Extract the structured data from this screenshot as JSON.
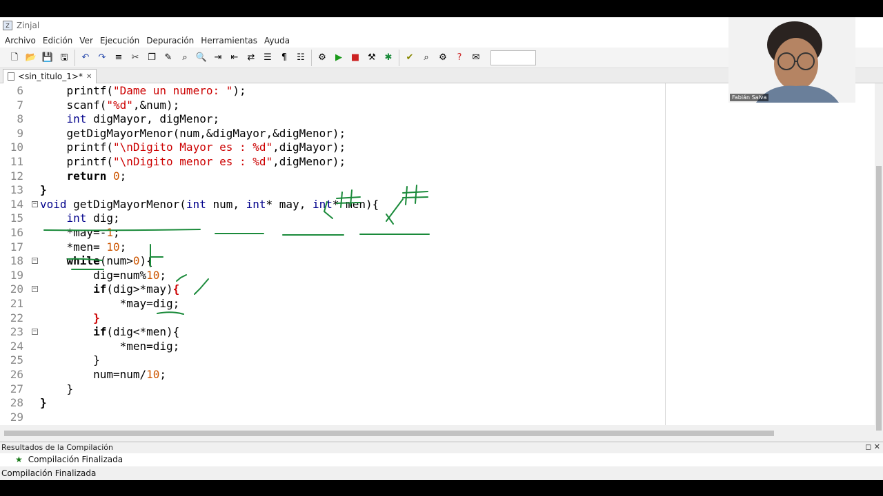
{
  "window": {
    "title": "Zinjal"
  },
  "menu": [
    "Archivo",
    "Edición",
    "Ver",
    "Ejecución",
    "Depuración",
    "Herramientas",
    "Ayuda"
  ],
  "toolbar": {
    "groups": [
      [
        "new-file-icon",
        "open-folder-icon",
        "save-icon",
        "save-as-icon"
      ],
      [
        "undo-icon",
        "redo-icon",
        "indent-icon",
        "cut-icon",
        "copy-icon",
        "comment-icon",
        "find-icon",
        "search-icon",
        "find-next-icon",
        "find-prev-icon",
        "replace-icon",
        "align-icon",
        "format-icon",
        "list-icon"
      ],
      [
        "compile-icon",
        "run-icon",
        "stop-icon",
        "build-icon",
        "debug-icon"
      ],
      [
        "check-icon",
        "inspect-icon",
        "tools-icon",
        "help-icon",
        "notes-icon"
      ]
    ]
  },
  "tabs": [
    {
      "label": "<sin_titulo_1>*"
    }
  ],
  "code_lines": [
    {
      "num": "6",
      "fold": "",
      "segments": [
        [
          "    ",
          "op"
        ],
        [
          "printf",
          "op"
        ],
        [
          "(",
          "op"
        ],
        [
          "\"Dame un numero: \"",
          "str"
        ],
        [
          ");",
          "op"
        ]
      ]
    },
    {
      "num": "7",
      "fold": "",
      "segments": [
        [
          "    ",
          "op"
        ],
        [
          "scanf",
          "op"
        ],
        [
          "(",
          "op"
        ],
        [
          "\"%d\"",
          "str"
        ],
        [
          ",&num);",
          "op"
        ]
      ]
    },
    {
      "num": "8",
      "fold": "",
      "segments": [
        [
          "    ",
          "op"
        ],
        [
          "int",
          "ty"
        ],
        [
          " digMayor, digMenor;",
          "op"
        ]
      ]
    },
    {
      "num": "9",
      "fold": "",
      "segments": [
        [
          "    ",
          "op"
        ],
        [
          "getDigMayorMenor(num,&digMayor,&digMenor);",
          "op"
        ]
      ]
    },
    {
      "num": "10",
      "fold": "",
      "segments": [
        [
          "    ",
          "op"
        ],
        [
          "printf(",
          "op"
        ],
        [
          "\"\\nDigito Mayor es : %d\"",
          "str"
        ],
        [
          ",digMayor);",
          "op"
        ]
      ]
    },
    {
      "num": "11",
      "fold": "",
      "segments": [
        [
          "    ",
          "op"
        ],
        [
          "printf(",
          "op"
        ],
        [
          "\"\\nDigito menor es : %d\"",
          "str"
        ],
        [
          ",digMenor);",
          "op"
        ]
      ]
    },
    {
      "num": "12",
      "fold": "",
      "segments": [
        [
          "    ",
          "op"
        ],
        [
          "return",
          "kw"
        ],
        [
          " ",
          "op"
        ],
        [
          "0",
          "num"
        ],
        [
          ";",
          "op"
        ]
      ]
    },
    {
      "num": "13",
      "fold": "",
      "segments": [
        [
          "}",
          "kw"
        ]
      ]
    },
    {
      "num": "14",
      "fold": "⊟",
      "segments": [
        [
          "void",
          "ty"
        ],
        [
          " getDigMayorMenor(",
          "op"
        ],
        [
          "int",
          "ty"
        ],
        [
          " num, ",
          "op"
        ],
        [
          "int",
          "ty"
        ],
        [
          "* may, ",
          "op"
        ],
        [
          "int",
          "ty"
        ],
        [
          "* men){",
          "op"
        ]
      ]
    },
    {
      "num": "15",
      "fold": "",
      "segments": [
        [
          "    ",
          "op"
        ],
        [
          "int",
          "ty"
        ],
        [
          " dig;",
          "op"
        ]
      ]
    },
    {
      "num": "16",
      "fold": "",
      "segments": [
        [
          "    ",
          "op"
        ],
        [
          "*may=-",
          "op"
        ],
        [
          "1",
          "num"
        ],
        [
          ";",
          "op"
        ]
      ]
    },
    {
      "num": "17",
      "fold": "",
      "segments": [
        [
          "    ",
          "op"
        ],
        [
          "*men= ",
          "op"
        ],
        [
          "10",
          "num"
        ],
        [
          ";",
          "op"
        ]
      ]
    },
    {
      "num": "18",
      "fold": "⊖",
      "segments": [
        [
          "    ",
          "op"
        ],
        [
          "while",
          "kw"
        ],
        [
          "(num>",
          "op"
        ],
        [
          "0",
          "num"
        ],
        [
          "){",
          "op"
        ]
      ]
    },
    {
      "num": "19",
      "fold": "",
      "segments": [
        [
          "        ",
          "op"
        ],
        [
          "dig=num%",
          "op"
        ],
        [
          "10",
          "num"
        ],
        [
          ";",
          "op"
        ]
      ]
    },
    {
      "num": "20",
      "fold": "⊖",
      "segments": [
        [
          "        ",
          "op"
        ],
        [
          "if",
          "kw"
        ],
        [
          "(dig>*may)",
          "op"
        ],
        [
          "{",
          "brace-red"
        ]
      ]
    },
    {
      "num": "21",
      "fold": "",
      "segments": [
        [
          "            ",
          "op"
        ],
        [
          "*may=dig;",
          "op"
        ]
      ]
    },
    {
      "num": "22",
      "fold": "",
      "segments": [
        [
          "        ",
          "op"
        ],
        [
          "}",
          "brace-red"
        ]
      ]
    },
    {
      "num": "23",
      "fold": "⊖",
      "segments": [
        [
          "        ",
          "op"
        ],
        [
          "if",
          "kw"
        ],
        [
          "(dig<*men){",
          "op"
        ]
      ]
    },
    {
      "num": "24",
      "fold": "",
      "segments": [
        [
          "            ",
          "op"
        ],
        [
          "*men=dig;",
          "op"
        ]
      ]
    },
    {
      "num": "25",
      "fold": "",
      "segments": [
        [
          "        ",
          "op"
        ],
        [
          "}",
          "op"
        ]
      ]
    },
    {
      "num": "26",
      "fold": "",
      "segments": [
        [
          "        ",
          "op"
        ],
        [
          "num=num/",
          "op"
        ],
        [
          "10",
          "num"
        ],
        [
          ";",
          "op"
        ]
      ]
    },
    {
      "num": "27",
      "fold": "",
      "segments": [
        [
          "    ",
          "op"
        ],
        [
          "}",
          "op"
        ]
      ]
    },
    {
      "num": "28",
      "fold": "",
      "segments": [
        [
          "}",
          "kw"
        ]
      ]
    },
    {
      "num": "29",
      "fold": "",
      "segments": []
    }
  ],
  "results": {
    "header": "Resultados de la Compilación",
    "controls": "◻ ✕",
    "items": [
      {
        "text": "Compilación Finalizada"
      }
    ]
  },
  "status": {
    "text": "Compilación Finalizada"
  },
  "webcam": {
    "name": "Fabián Salva"
  },
  "colors": {
    "ink": "#1a8a3a",
    "string": "#cc0000",
    "type": "#00008b",
    "number": "#cc5500"
  }
}
